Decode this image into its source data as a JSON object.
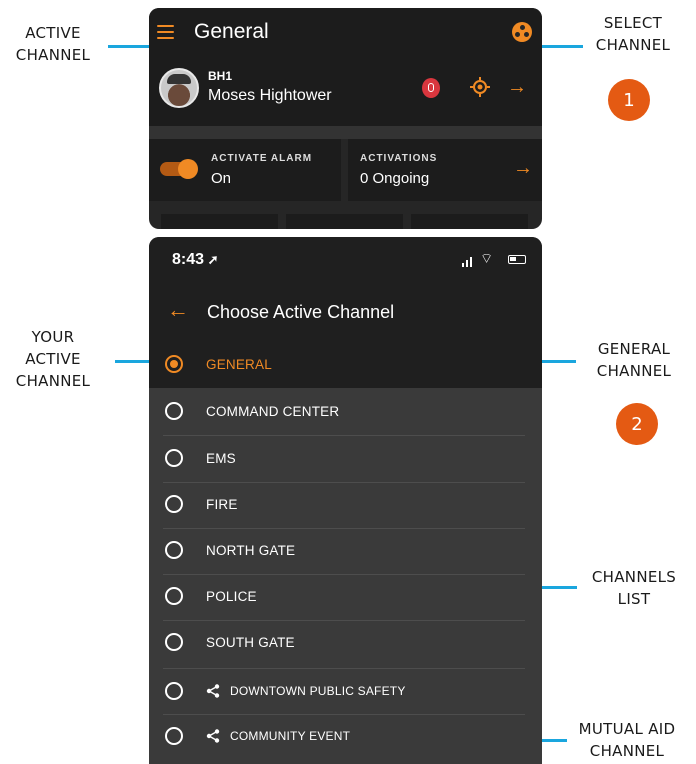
{
  "callouts": {
    "active_channel": "ACTIVE\nCHANNEL",
    "select_channel": "SELECT\nCHANNEL",
    "your_active_channel": "YOUR\nACTIVE\nCHANNEL",
    "general_channel": "GENERAL\nCHANNEL",
    "channels_list": "CHANNELS\nLIST",
    "mutual_aid_channel": "MUTUAL AID\nCHANNEL"
  },
  "badges": [
    "1",
    "2"
  ],
  "panel1": {
    "title": "General",
    "user": {
      "id": "BH1",
      "name": "Moses Hightower"
    },
    "alarm": {
      "label": "ACTIVATE ALARM",
      "value": "On"
    },
    "activations": {
      "label": "ACTIVATIONS",
      "value": "0 Ongoing"
    }
  },
  "panel2": {
    "time": "8:43",
    "title": "Choose Active Channel",
    "selected": "GENERAL",
    "channels": [
      "COMMAND CENTER",
      "EMS",
      "FIRE",
      "NORTH GATE",
      "POLICE",
      "SOUTH GATE"
    ],
    "shared_channels": [
      "DOWNTOWN PUBLIC SAFETY",
      "COMMUNITY EVENT"
    ]
  },
  "colors": {
    "accent": "#f08a24",
    "callout_line": "#1aa6de",
    "badge": "#e45a13"
  }
}
